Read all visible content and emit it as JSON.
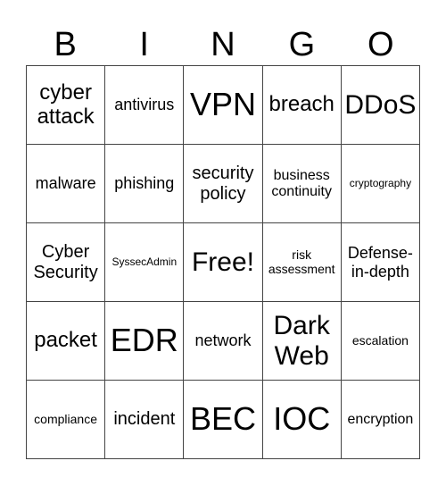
{
  "header": [
    "B",
    "I",
    "N",
    "G",
    "O"
  ],
  "cells": [
    {
      "text": "cyber attack",
      "size": "s-m"
    },
    {
      "text": "antivirus",
      "size": "s-s"
    },
    {
      "text": "VPN",
      "size": "s-xl"
    },
    {
      "text": "breach",
      "size": "s-m"
    },
    {
      "text": "DDoS",
      "size": "s-l"
    },
    {
      "text": "malware",
      "size": "s-s"
    },
    {
      "text": "phishing",
      "size": "s-s"
    },
    {
      "text": "security policy",
      "size": "s-ms"
    },
    {
      "text": "business continuity",
      "size": "s-xs"
    },
    {
      "text": "cryptography",
      "size": "s-tiny"
    },
    {
      "text": "Cyber Security",
      "size": "s-ms"
    },
    {
      "text": "SyssecAdmin",
      "size": "s-tiny"
    },
    {
      "text": "Free!",
      "size": "s-l"
    },
    {
      "text": "risk assessment",
      "size": "s-xxs"
    },
    {
      "text": "Defense-in-depth",
      "size": "s-s"
    },
    {
      "text": "packet",
      "size": "s-m"
    },
    {
      "text": "EDR",
      "size": "s-xl"
    },
    {
      "text": "network",
      "size": "s-s"
    },
    {
      "text": "Dark Web",
      "size": "s-l"
    },
    {
      "text": "escalation",
      "size": "s-xxs"
    },
    {
      "text": "compliance",
      "size": "s-xxs"
    },
    {
      "text": "incident",
      "size": "s-ms"
    },
    {
      "text": "BEC",
      "size": "s-xl"
    },
    {
      "text": "IOC",
      "size": "s-xl"
    },
    {
      "text": "encryption",
      "size": "s-xs"
    }
  ]
}
